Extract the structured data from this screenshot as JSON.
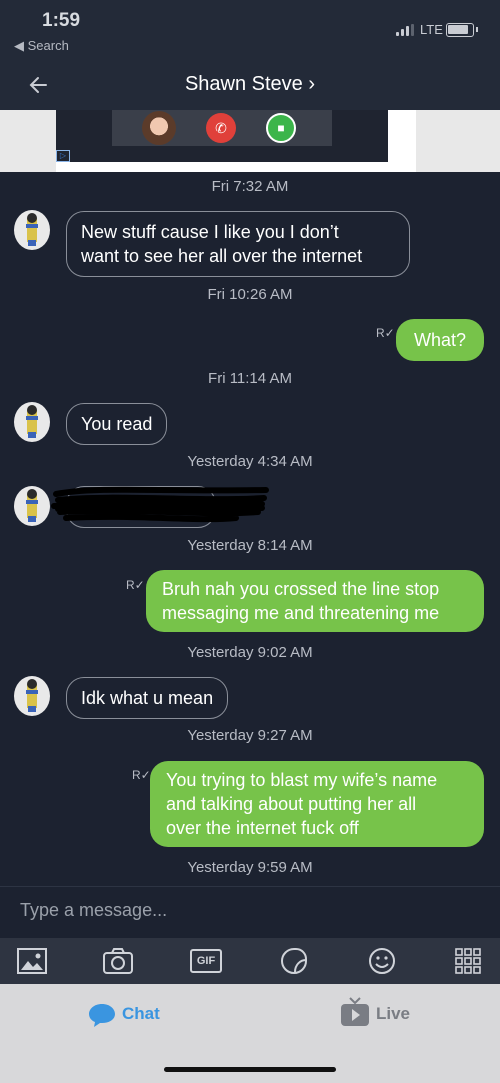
{
  "status_bar": {
    "time": "1:59",
    "back_label": "◀ Search",
    "network": "LTE"
  },
  "header": {
    "title": "Shawn Steve ›"
  },
  "messages": [
    {
      "type": "timestamp",
      "text": "Fri 7:32 AM"
    },
    {
      "type": "incoming",
      "text_lines": [
        "New stuff cause I like you I don’t",
        "want to see her all over the internet"
      ]
    },
    {
      "type": "timestamp",
      "text": "Fri 10:26 AM"
    },
    {
      "type": "outgoing",
      "text": "What?"
    },
    {
      "type": "timestamp",
      "text": "Fri 11:14 AM"
    },
    {
      "type": "incoming",
      "text": "You read"
    },
    {
      "type": "timestamp",
      "text": "Yesterday 4:34 AM"
    },
    {
      "type": "incoming-redacted"
    },
    {
      "type": "timestamp",
      "text": "Yesterday 8:14 AM"
    },
    {
      "type": "outgoing",
      "text_lines": [
        "Bruh nah you crossed the line stop",
        "messaging me and threatening me"
      ]
    },
    {
      "type": "timestamp",
      "text": "Yesterday 9:02 AM"
    },
    {
      "type": "incoming",
      "text": "Idk what u mean"
    },
    {
      "type": "timestamp",
      "text": "Yesterday 9:27 AM"
    },
    {
      "type": "outgoing",
      "text_lines": [
        "You trying to blast my wife’s name",
        "and talking about putting her all",
        "over the internet fuck off"
      ]
    },
    {
      "type": "timestamp",
      "text": "Yesterday 9:59 AM"
    }
  ],
  "read_marker": "R",
  "composer": {
    "placeholder": "Type a message..."
  },
  "toolbar": {
    "gif_label": "GIF",
    "icons": [
      "image-icon",
      "camera-icon",
      "gif-icon",
      "sticker-icon",
      "emoji-icon",
      "apps-grid-icon"
    ]
  },
  "tabs": {
    "chat": "Chat",
    "live": "Live"
  },
  "colors": {
    "background": "#1c2230",
    "outgoing_bubble": "#77c34a",
    "chat_tab": "#3a95e0"
  }
}
